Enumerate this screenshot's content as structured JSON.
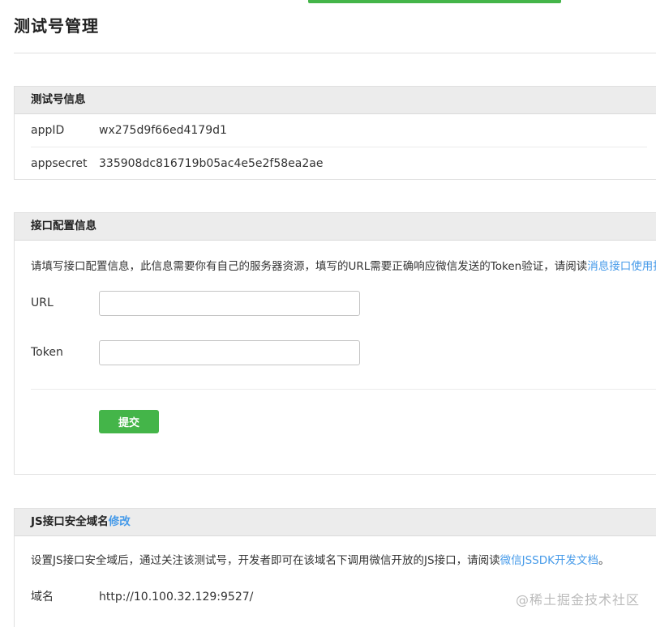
{
  "page": {
    "title": "测试号管理",
    "accent_color": "#44b549",
    "link_color": "#459ae9"
  },
  "test_account": {
    "heading": "测试号信息",
    "rows": [
      {
        "key": "appID",
        "value": "wx275d9f66ed4179d1"
      },
      {
        "key": "appsecret",
        "value": "335908dc816719b05ac4e5e2f58ea2ae"
      }
    ]
  },
  "interface_config": {
    "heading": "接口配置信息",
    "description": "请填写接口配置信息，此信息需要你有自己的服务器资源，填写的URL需要正确响应微信发送的Token验证，请阅读",
    "description_link": "消息接口使用指南",
    "url_label": "URL",
    "url_value": "",
    "token_label": "Token",
    "token_value": "",
    "submit_label": "提交"
  },
  "js_domain": {
    "heading": "JS接口安全域名",
    "edit_link": "修改",
    "description": "设置JS接口安全域后，通过关注该测试号，开发者即可在该域名下调用微信开放的JS接口，请阅读",
    "description_link": "微信JSSDK开发文档",
    "description_end": "。",
    "domain_label": "域名",
    "domain_value": "http://10.100.32.129:9527/"
  },
  "watermark": "@稀土掘金技术社区"
}
